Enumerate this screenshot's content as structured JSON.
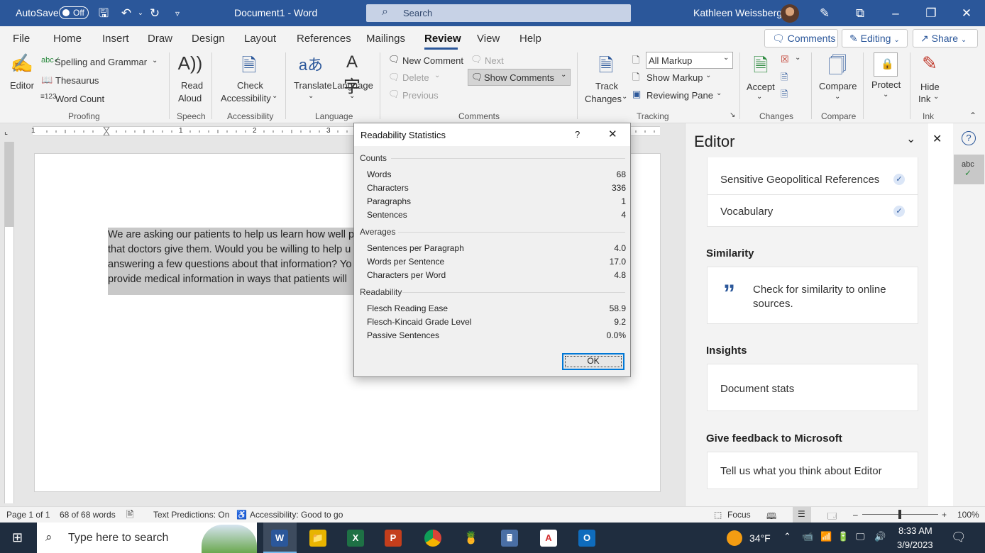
{
  "titlebar": {
    "autosave_label": "AutoSave",
    "autosave_state": "Off",
    "doc_title": "Document1  -  Word",
    "search_placeholder": "Search",
    "user_name": "Kathleen Weissberg"
  },
  "menu": {
    "items": [
      "File",
      "Home",
      "Insert",
      "Draw",
      "Design",
      "Layout",
      "References",
      "Mailings",
      "Review",
      "View",
      "Help"
    ],
    "active": "Review",
    "comments_label": "Comments",
    "editing_label": "Editing",
    "share_label": "Share"
  },
  "ribbon": {
    "proofing": {
      "editor": "Editor",
      "spelling": "Spelling and Grammar",
      "thesaurus": "Thesaurus",
      "word_count": "Word Count",
      "group": "Proofing"
    },
    "speech": {
      "read": "Read",
      "aloud": "Aloud",
      "group": "Speech"
    },
    "accessibility": {
      "check": "Check",
      "accessibility": "Accessibility",
      "group": "Accessibility"
    },
    "language": {
      "translate": "Translate",
      "language": "Language",
      "group": "Language"
    },
    "comments": {
      "new_comment": "New Comment",
      "next": "Next",
      "delete": "Delete",
      "previous": "Previous",
      "show_comments": "Show Comments",
      "group": "Comments"
    },
    "tracking": {
      "track": "Track",
      "changes": "Changes",
      "markup_value": "All Markup",
      "show_markup": "Show Markup",
      "reviewing_pane": "Reviewing Pane",
      "group": "Tracking"
    },
    "changes": {
      "accept": "Accept",
      "group": "Changes"
    },
    "compare": {
      "compare": "Compare",
      "group": "Compare"
    },
    "protect": {
      "protect": "Protect"
    },
    "ink": {
      "hide": "Hide",
      "ink": "Ink",
      "group": "Ink"
    }
  },
  "ruler": {
    "marks": [
      "1",
      "1",
      "2",
      "3"
    ]
  },
  "document": {
    "lines": [
      "We are asking our patients to help us learn how well p",
      "that doctors give them. Would you be willing to help u",
      "answering a few questions about that information? Yo",
      "provide medical information in ways that patients will"
    ]
  },
  "dialog": {
    "title": "Readability Statistics",
    "help": "?",
    "counts_label": "Counts",
    "counts": [
      {
        "label": "Words",
        "value": "68"
      },
      {
        "label": "Characters",
        "value": "336"
      },
      {
        "label": "Paragraphs",
        "value": "1"
      },
      {
        "label": "Sentences",
        "value": "4"
      }
    ],
    "averages_label": "Averages",
    "averages": [
      {
        "label": "Sentences per Paragraph",
        "value": "4.0"
      },
      {
        "label": "Words per Sentence",
        "value": "17.0"
      },
      {
        "label": "Characters per Word",
        "value": "4.8"
      }
    ],
    "readability_label": "Readability",
    "readability": [
      {
        "label": "Flesch Reading Ease",
        "value": "58.9"
      },
      {
        "label": "Flesch-Kincaid Grade Level",
        "value": "9.2"
      },
      {
        "label": "Passive Sentences",
        "value": "0.0%"
      }
    ],
    "ok": "OK"
  },
  "editor_pane": {
    "title": "Editor",
    "refinements": [
      "Sensitive Geopolitical References",
      "Vocabulary"
    ],
    "similarity_title": "Similarity",
    "similarity_text_1": "Check for similarity to online",
    "similarity_text_2": "sources.",
    "insights_title": "Insights",
    "insights_text": "Document stats",
    "feedback_title": "Give feedback to Microsoft",
    "feedback_text": "Tell us what you think about Editor",
    "abc": "abc"
  },
  "statusbar": {
    "page": "Page 1 of 1",
    "words": "68 of 68 words",
    "text_predictions": "Text Predictions: On",
    "accessibility": "Accessibility: Good to go",
    "focus": "Focus",
    "zoom": "100%"
  },
  "taskbar": {
    "search_placeholder": "Type here to search",
    "temperature": "34°F",
    "time": "8:33 AM",
    "date": "3/9/2023"
  },
  "colors": {
    "brand": "#2b579a",
    "dialog_bg": "#f0f0f0",
    "taskbar": "#1f2d3f"
  }
}
